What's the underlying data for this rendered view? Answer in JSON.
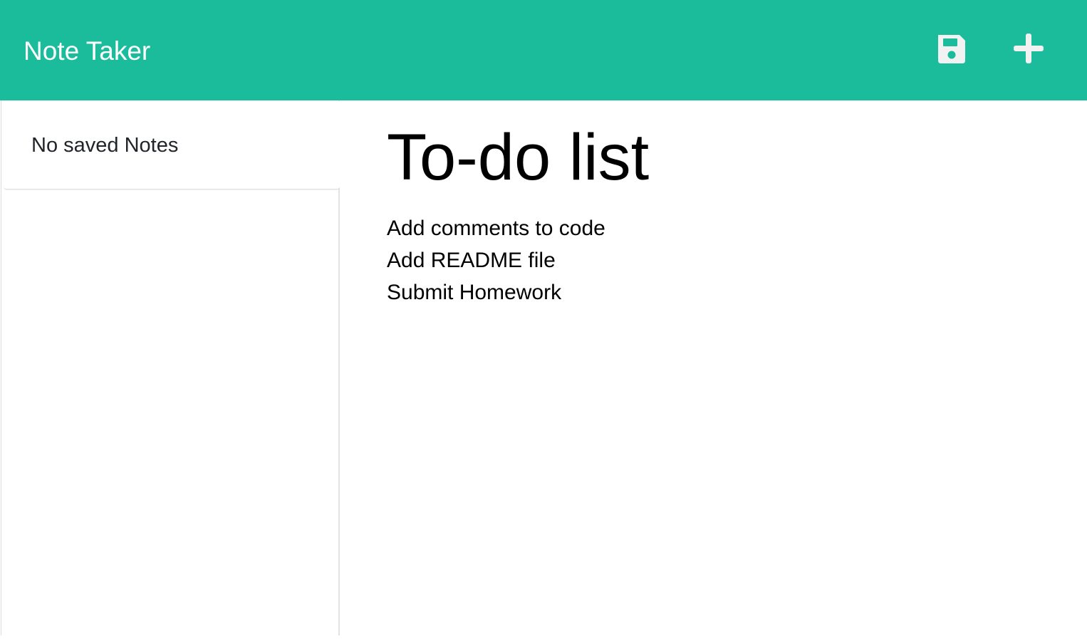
{
  "header": {
    "brand": "Note Taker",
    "save_icon": "save-icon",
    "add_icon": "plus-icon",
    "accent_color": "#1abc9c"
  },
  "sidebar": {
    "empty_message": "No saved Notes"
  },
  "note": {
    "title": "To-do list",
    "lines": [
      "Add comments to code",
      "Add README file",
      "Submit Homework"
    ]
  }
}
